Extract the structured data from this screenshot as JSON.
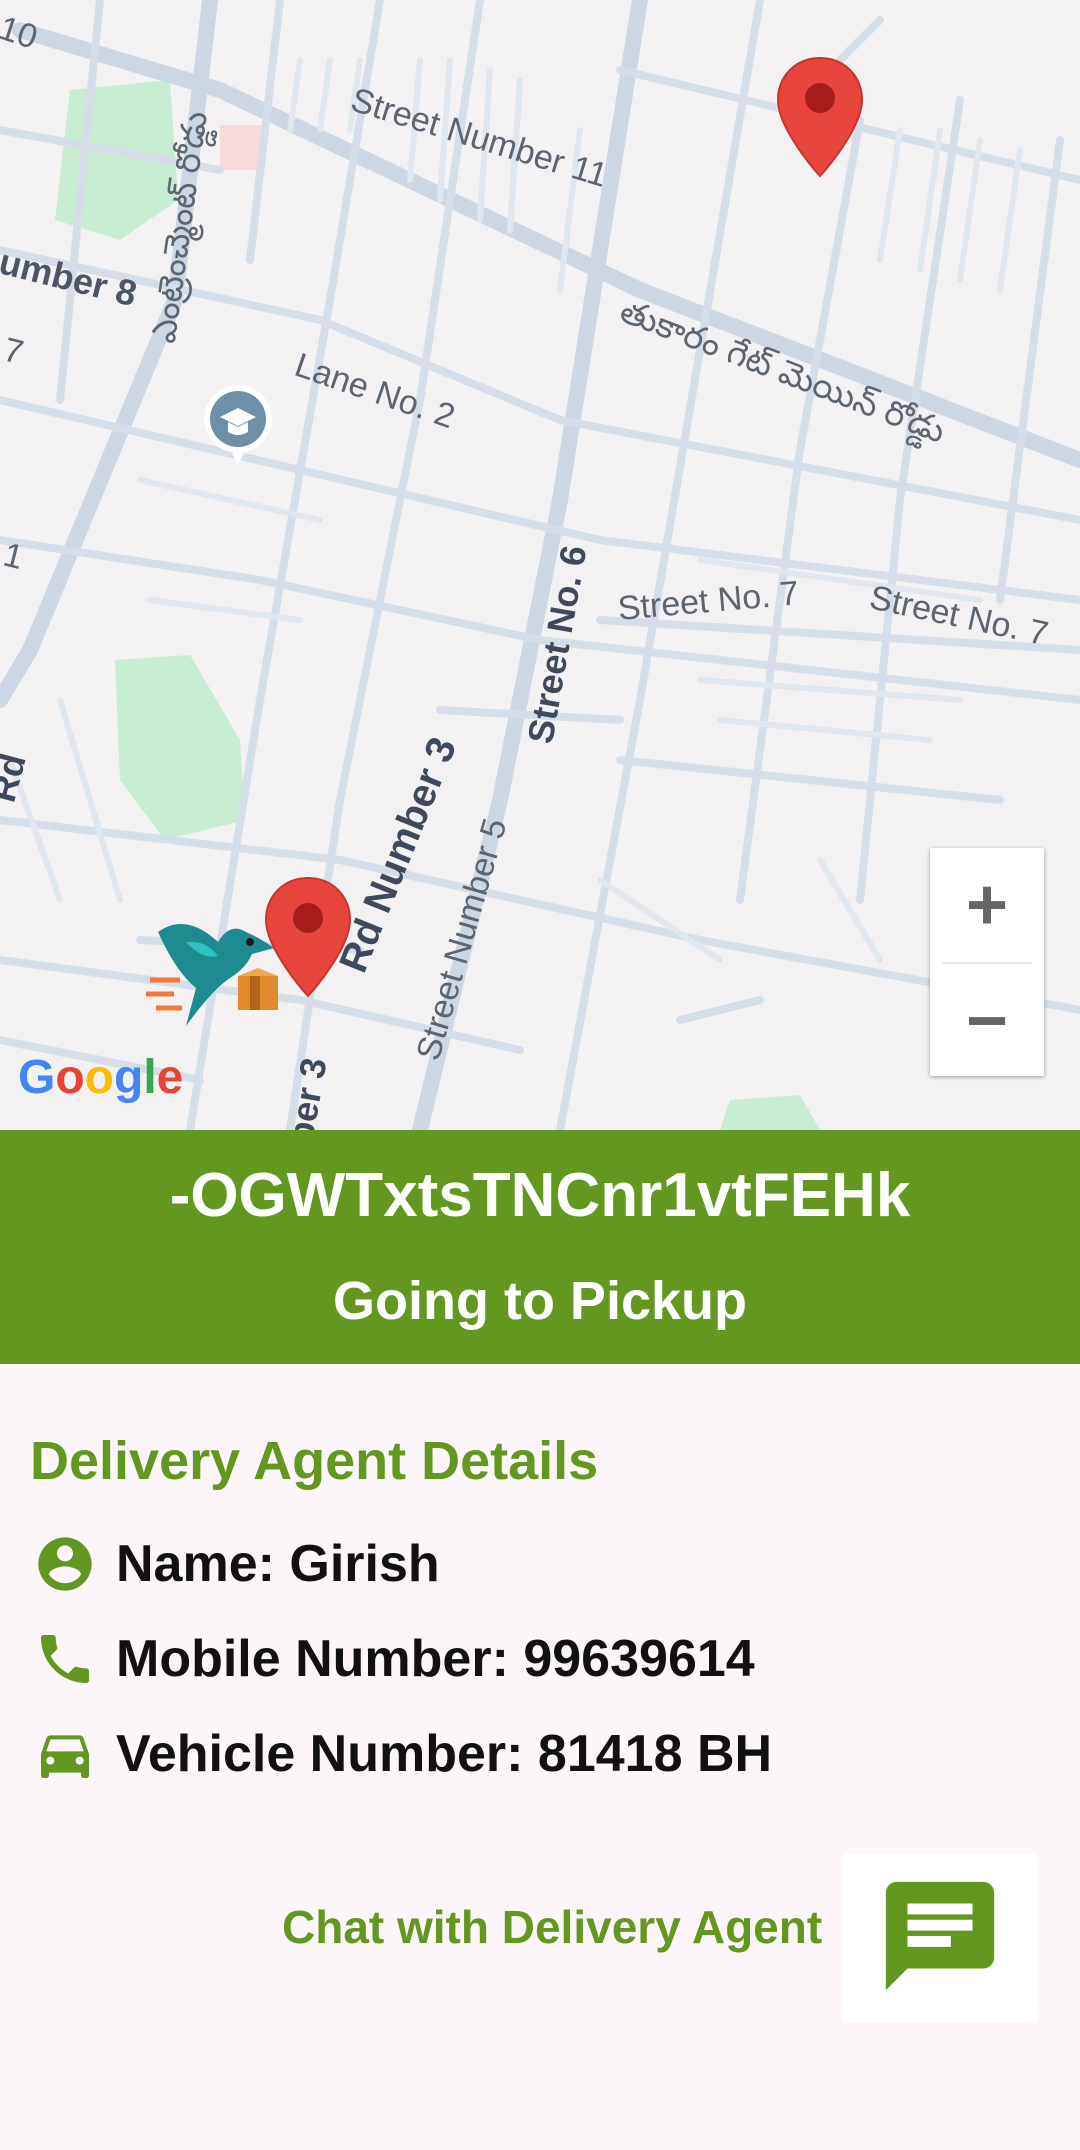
{
  "map": {
    "labels": [
      {
        "name": "street-number-10",
        "text": "10"
      },
      {
        "name": "street-number-11",
        "text": "Street Number 11"
      },
      {
        "name": "street-number-8",
        "text": "umber 8"
      },
      {
        "name": "telugu-road-left",
        "text": "ఎంట్రెంచ్మెంట్ రోడ్డు"
      },
      {
        "name": "tukaram-gate-main-road",
        "text": "తుకారం గేట్ మెయిన్ రోడ్డు"
      },
      {
        "name": "lane-no-2",
        "text": "Lane No. 2"
      },
      {
        "name": "street-no-6",
        "text": "Street No. 6"
      },
      {
        "name": "street-no-7-a",
        "text": "Street No. 7"
      },
      {
        "name": "street-no-7-b",
        "text": "Street No. 7"
      },
      {
        "name": "rd-number-3",
        "text": "Rd Number 3"
      },
      {
        "name": "street-number-5",
        "text": "Street Number 5"
      },
      {
        "name": "number-3-bottom",
        "text": "ber 3"
      },
      {
        "name": "rd-left",
        "text": "Rd"
      },
      {
        "name": "edge-7",
        "text": "7"
      },
      {
        "name": "edge-1",
        "text": "1"
      }
    ],
    "zoom_in_label": "+",
    "zoom_out_label": "−",
    "google_logo": "Google",
    "colors": {
      "pin": "#e8453c",
      "park": "#c8ecd2",
      "road": "#ccd7e3",
      "marker_school": "#5f7f9a"
    }
  },
  "header": {
    "order_id": "-OGWTxtsTNCnr1vtFEHk",
    "status": "Going to Pickup",
    "background": "#64971f"
  },
  "agent": {
    "section_title": "Delivery Agent Details",
    "name": "Name: Girish",
    "mobile": "Mobile Number: 99639614",
    "vehicle": "Vehicle Number: 81418 BH",
    "icons": [
      "person-icon",
      "phone-icon",
      "car-icon"
    ]
  },
  "chat": {
    "label": "Chat with Delivery Agent",
    "icon": "chat-icon"
  }
}
